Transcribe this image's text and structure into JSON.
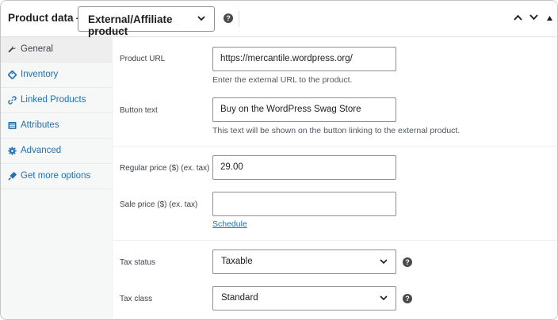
{
  "header": {
    "title": "Product data —",
    "product_type": "External/Affiliate product",
    "help_glyph": "?",
    "move_up_icon": "chevron-up-icon",
    "move_down_icon": "chevron-down-icon",
    "toggle_icon": "triangle-up-icon"
  },
  "sidebar": {
    "items": [
      {
        "label": "General",
        "icon": "wrench-icon",
        "active": true
      },
      {
        "label": "Inventory",
        "icon": "tag-icon",
        "active": false
      },
      {
        "label": "Linked Products",
        "icon": "link-icon",
        "active": false
      },
      {
        "label": "Attributes",
        "icon": "list-icon",
        "active": false
      },
      {
        "label": "Advanced",
        "icon": "gear-icon",
        "active": false
      },
      {
        "label": "Get more options",
        "icon": "plugin-icon",
        "active": false
      }
    ]
  },
  "general": {
    "product_url": {
      "label": "Product URL",
      "value": "https://mercantile.wordpress.org/",
      "description": "Enter the external URL to the product."
    },
    "button_text": {
      "label": "Button text",
      "value": "Buy on the WordPress Swag Store",
      "description": "This text will be shown on the button linking to the external product."
    },
    "regular_price": {
      "label": "Regular price ($) (ex. tax)",
      "value": "29.00"
    },
    "sale_price": {
      "label": "Sale price ($) (ex. tax)",
      "value": "",
      "schedule_link": "Schedule"
    },
    "tax_status": {
      "label": "Tax status",
      "selected": "Taxable"
    },
    "tax_class": {
      "label": "Tax class",
      "selected": "Standard"
    }
  },
  "colors": {
    "link": "#2271b1",
    "border": "#8c8f94",
    "sidebar_bg": "#f6f7f7"
  }
}
